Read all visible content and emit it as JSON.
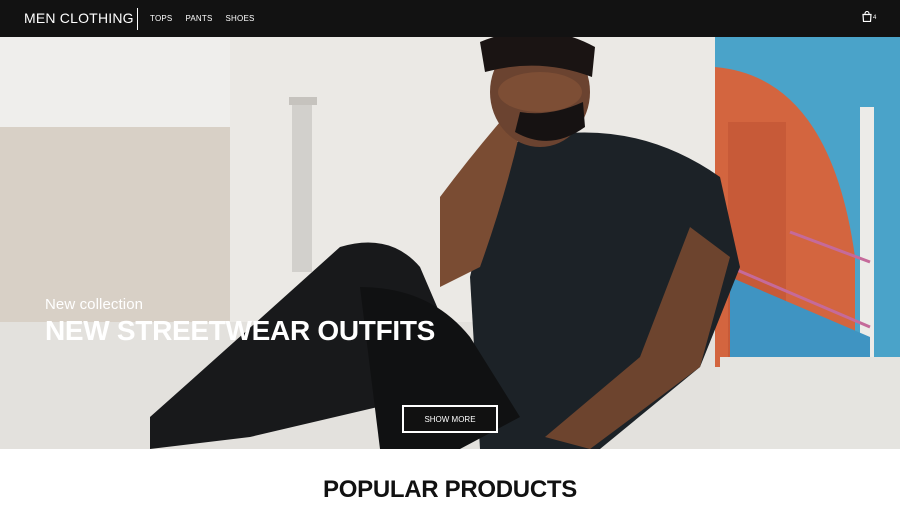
{
  "header": {
    "brand": "MEN CLOTHING",
    "nav": [
      {
        "label": "TOPS"
      },
      {
        "label": "PANTS"
      },
      {
        "label": "SHOES"
      }
    ],
    "cart": {
      "icon": "shopping-bag-icon",
      "count": "4"
    }
  },
  "hero": {
    "subtitle": "New collection",
    "title": "NEW STREETWEAR OUTFITS",
    "button_label": "SHOW MORE",
    "image": "man-sitting-streetwear-photo"
  },
  "section": {
    "heading": "POPULAR PRODUCTS"
  },
  "colors": {
    "header_bg": "#121212",
    "text_light": "#ffffff",
    "text_dark": "#111111"
  }
}
